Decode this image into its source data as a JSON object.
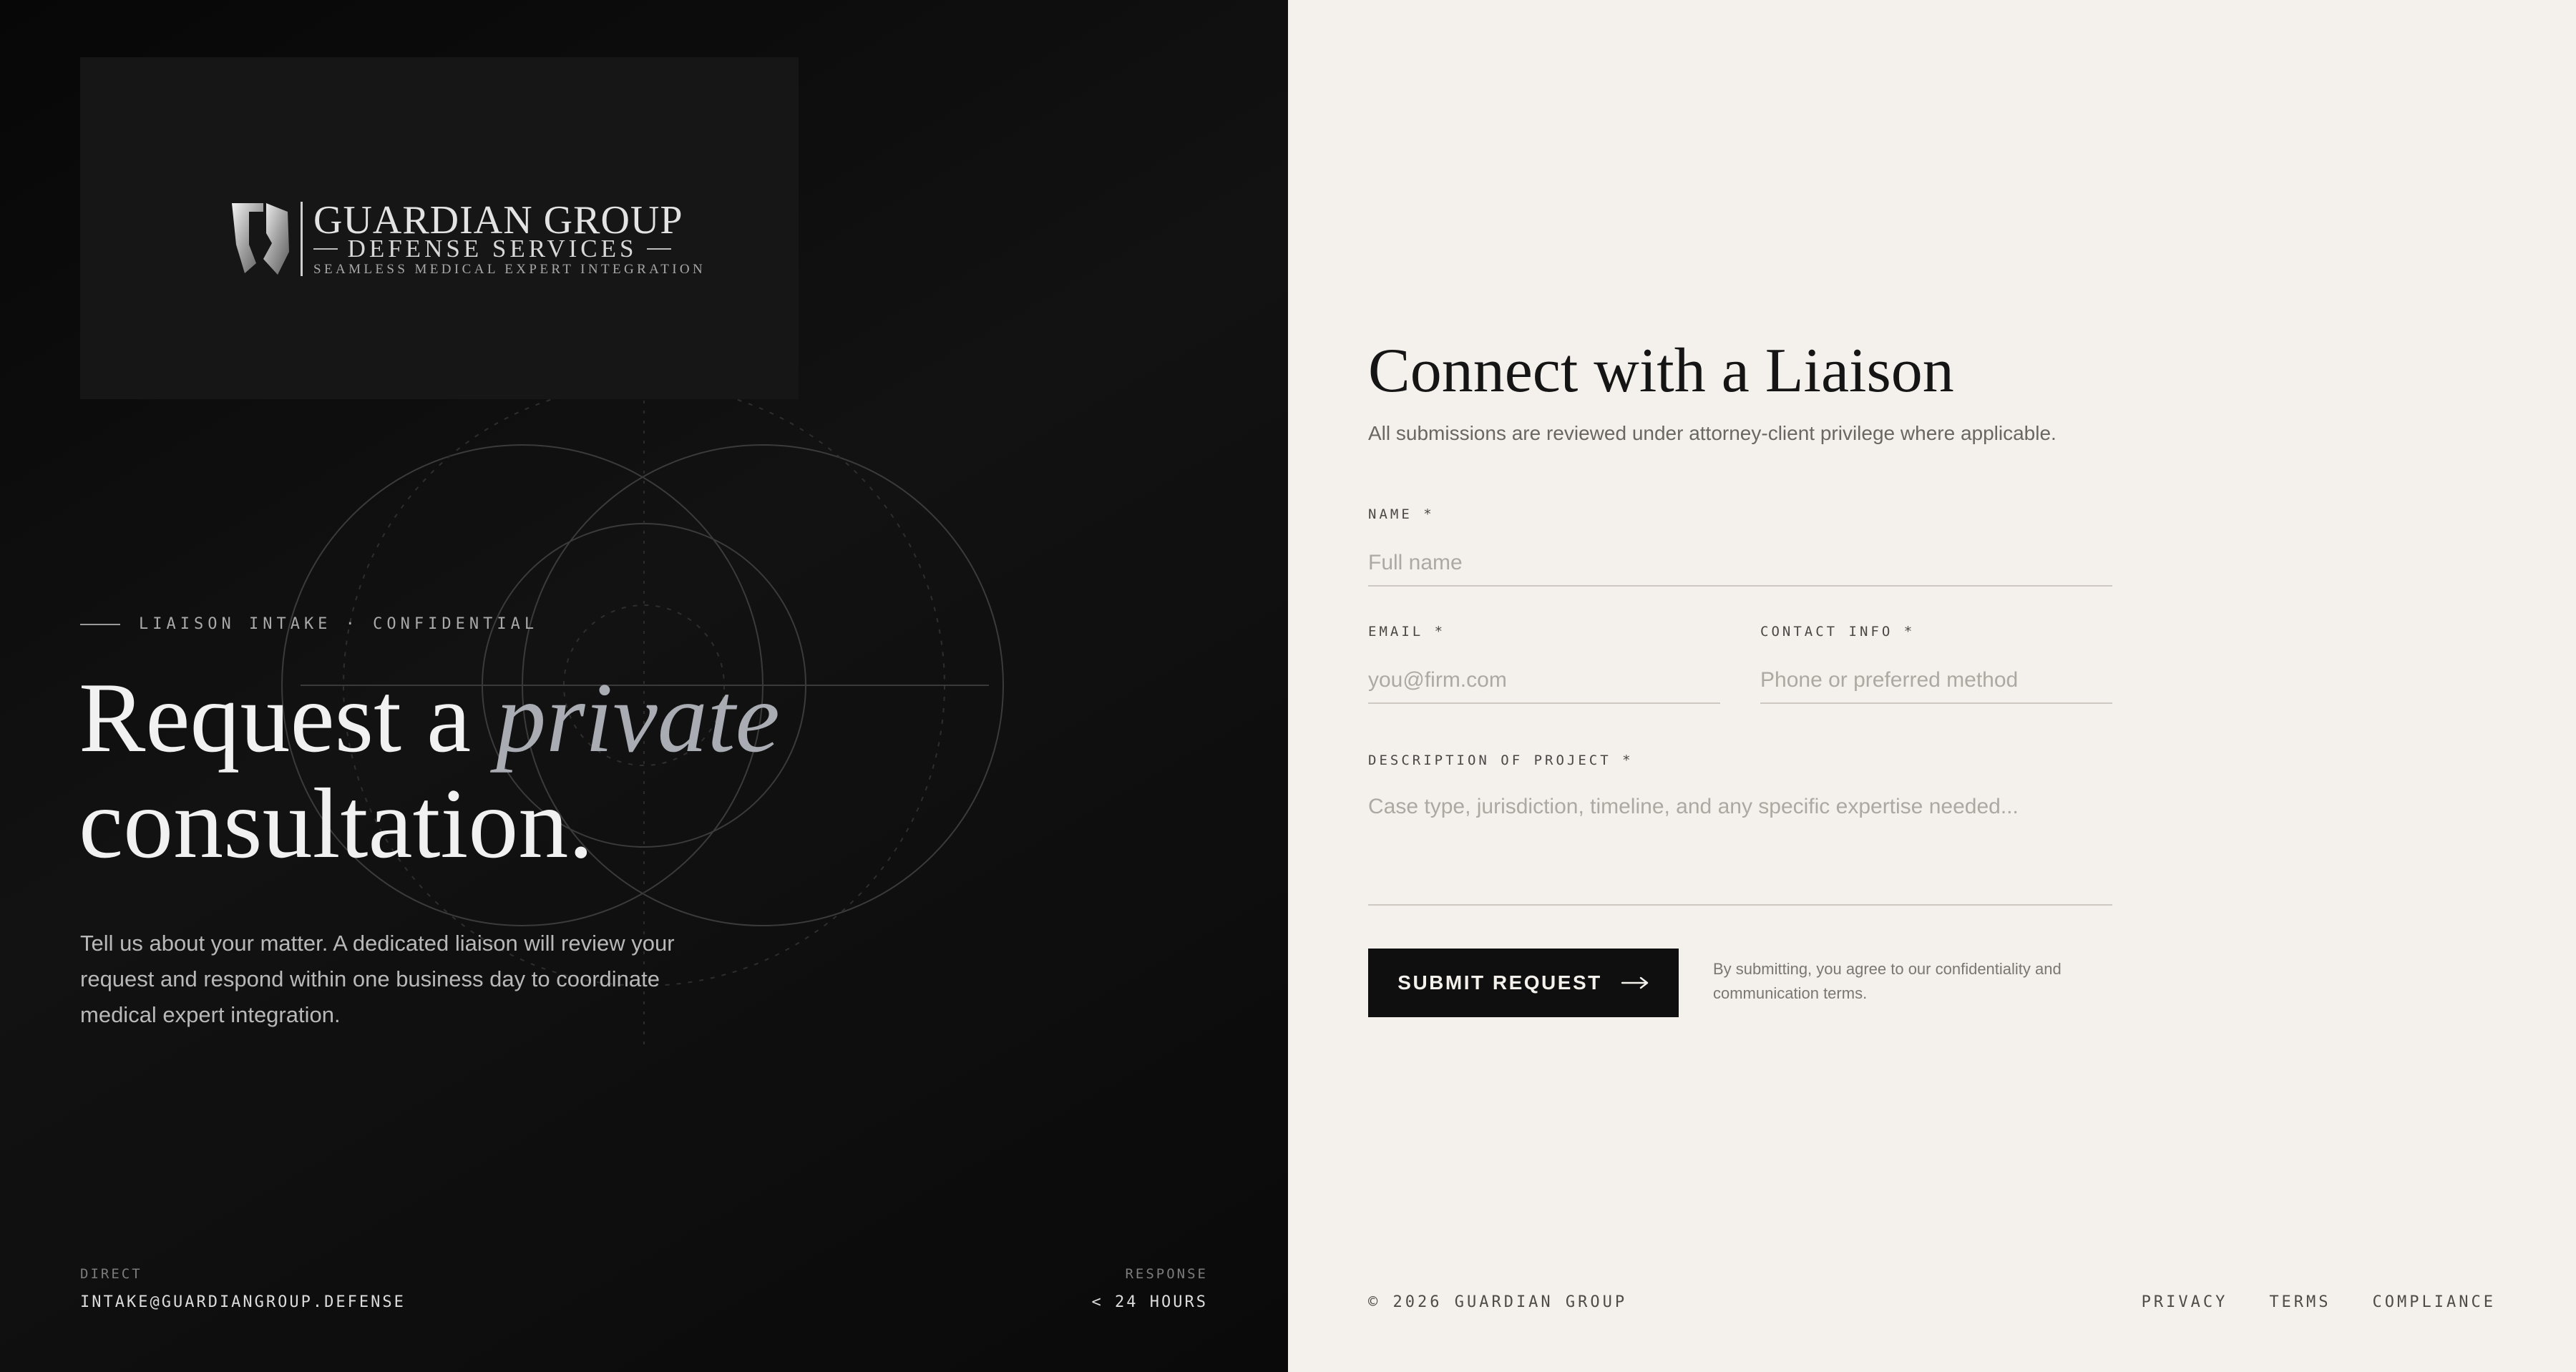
{
  "brand": {
    "name": "GUARDIAN GROUP",
    "division": "DEFENSE SERVICES",
    "tagline": "SEAMLESS MEDICAL EXPERT INTEGRATION"
  },
  "hero": {
    "eyebrow": "LIAISON INTAKE · CONFIDENTIAL",
    "headline_start": "Request a ",
    "headline_emphasis": "private",
    "headline_end": "consultation.",
    "lead": "Tell us about your matter. A dedicated liaison will review your request and respond within one business day to coordinate medical expert integration."
  },
  "contact": {
    "direct_label": "DIRECT",
    "direct_value": "INTAKE@GUARDIANGROUP.DEFENSE",
    "response_label": "RESPONSE",
    "response_value": "< 24 HOURS"
  },
  "form": {
    "title": "Connect with a Liaison",
    "subtitle": "All submissions are reviewed under attorney-client privilege where applicable.",
    "name_label": "NAME *",
    "name_placeholder": "Full name",
    "email_label": "EMAIL *",
    "email_placeholder": "you@firm.com",
    "contact_label": "CONTACT INFO *",
    "contact_placeholder": "Phone or preferred method",
    "description_label": "DESCRIPTION OF PROJECT *",
    "description_placeholder": "Case type, jurisdiction, timeline, and any specific expertise needed...",
    "submit_label": "SUBMIT REQUEST",
    "consent": "By submitting, you agree to our confidentiality and communication terms."
  },
  "footer": {
    "copyright": "© 2026 GUARDIAN GROUP",
    "links": [
      "PRIVACY",
      "TERMS",
      "COMPLIANCE"
    ]
  },
  "colors": {
    "dark_panel": "#0d0d0d",
    "light_panel": "#f4f1ec",
    "accent_italic": "#a9acb3",
    "button": "#0f0f0f"
  },
  "icons": {
    "logo": "shield-helmet-logo-icon",
    "submit": "arrow-right-icon"
  }
}
